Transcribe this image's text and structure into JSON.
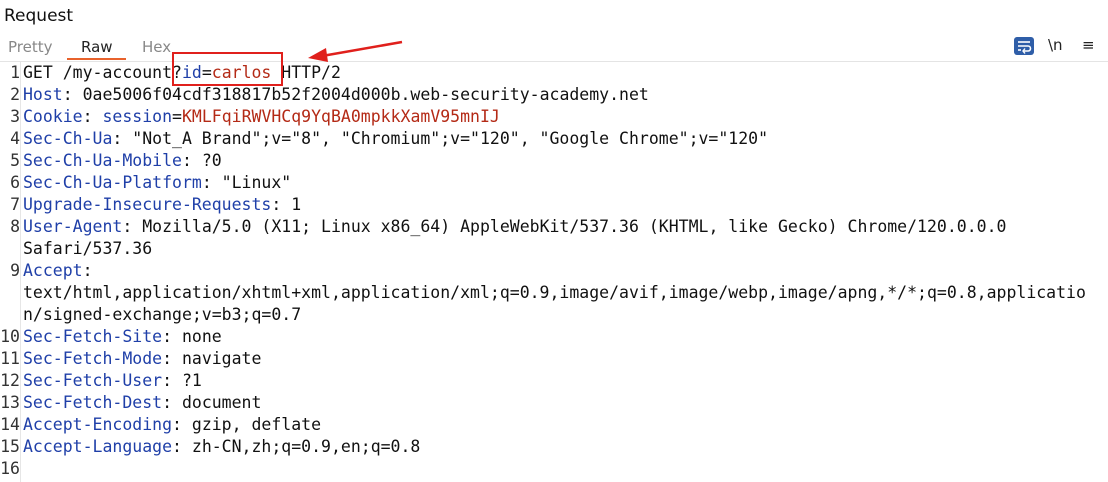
{
  "panel": {
    "title": "Request"
  },
  "tabs": [
    {
      "label": "Pretty",
      "active": false
    },
    {
      "label": "Raw",
      "active": true
    },
    {
      "label": "Hex",
      "active": false
    }
  ],
  "toolbar": {
    "wrap_icon": "word-wrap-icon",
    "newline_label": "\\n",
    "menu_label": "≡"
  },
  "colors": {
    "key": "#1f3fa8",
    "value": "#b42a16",
    "accent_tab": "#e8622c",
    "highlight_box": "#e0201c"
  },
  "lines": [
    {
      "n": "1",
      "parts": [
        {
          "t": "GET /my-account",
          "c": "p"
        },
        {
          "t": "?",
          "c": "p"
        },
        {
          "t": "id",
          "c": "k"
        },
        {
          "t": "=",
          "c": "p"
        },
        {
          "t": "carlos",
          "c": "v"
        },
        {
          "t": " HTTP/2",
          "c": "p"
        }
      ]
    },
    {
      "n": "2",
      "parts": [
        {
          "t": "Host",
          "c": "k"
        },
        {
          "t": ": 0ae5006f04cdf318817b52f2004d000b.web-security-academy.net",
          "c": "p"
        }
      ]
    },
    {
      "n": "3",
      "parts": [
        {
          "t": "Cookie",
          "c": "k"
        },
        {
          "t": ": ",
          "c": "p"
        },
        {
          "t": "session",
          "c": "k"
        },
        {
          "t": "=",
          "c": "p"
        },
        {
          "t": "KMLFqiRWVHCq9YqBA0mpkkXamV95mnIJ",
          "c": "v"
        }
      ]
    },
    {
      "n": "4",
      "parts": [
        {
          "t": "Sec-Ch-Ua",
          "c": "k"
        },
        {
          "t": ": \"Not_A Brand\";v=\"8\", \"Chromium\";v=\"120\", \"Google Chrome\";v=\"120\"",
          "c": "p"
        }
      ]
    },
    {
      "n": "5",
      "parts": [
        {
          "t": "Sec-Ch-Ua-Mobile",
          "c": "k"
        },
        {
          "t": ": ?0",
          "c": "p"
        }
      ]
    },
    {
      "n": "6",
      "parts": [
        {
          "t": "Sec-Ch-Ua-Platform",
          "c": "k"
        },
        {
          "t": ": \"Linux\"",
          "c": "p"
        }
      ]
    },
    {
      "n": "7",
      "parts": [
        {
          "t": "Upgrade-Insecure-Requests",
          "c": "k"
        },
        {
          "t": ": 1",
          "c": "p"
        }
      ]
    },
    {
      "n": "8",
      "parts": [
        {
          "t": "User-Agent",
          "c": "k"
        },
        {
          "t": ": Mozilla/5.0 (X11; Linux x86_64) AppleWebKit/537.36 (KHTML, like Gecko) Chrome/120.0.0.0",
          "c": "p"
        }
      ]
    },
    {
      "n": "",
      "parts": [
        {
          "t": "Safari/537.36",
          "c": "p"
        }
      ]
    },
    {
      "n": "9",
      "parts": [
        {
          "t": "Accept",
          "c": "k"
        },
        {
          "t": ":",
          "c": "p"
        }
      ]
    },
    {
      "n": "",
      "parts": [
        {
          "t": "text/html,application/xhtml+xml,application/xml;q=0.9,image/avif,image/webp,image/apng,*/*;q=0.8,applicatio",
          "c": "p"
        }
      ]
    },
    {
      "n": "",
      "parts": [
        {
          "t": "n/signed-exchange;v=b3;q=0.7",
          "c": "p"
        }
      ]
    },
    {
      "n": "10",
      "parts": [
        {
          "t": "Sec-Fetch-Site",
          "c": "k"
        },
        {
          "t": ": none",
          "c": "p"
        }
      ]
    },
    {
      "n": "11",
      "parts": [
        {
          "t": "Sec-Fetch-Mode",
          "c": "k"
        },
        {
          "t": ": navigate",
          "c": "p"
        }
      ]
    },
    {
      "n": "12",
      "parts": [
        {
          "t": "Sec-Fetch-User",
          "c": "k"
        },
        {
          "t": ": ?1",
          "c": "p"
        }
      ]
    },
    {
      "n": "13",
      "parts": [
        {
          "t": "Sec-Fetch-Dest",
          "c": "k"
        },
        {
          "t": ": document",
          "c": "p"
        }
      ]
    },
    {
      "n": "14",
      "parts": [
        {
          "t": "Accept-Encoding",
          "c": "k"
        },
        {
          "t": ": gzip, deflate",
          "c": "p"
        }
      ]
    },
    {
      "n": "15",
      "parts": [
        {
          "t": "Accept-Language",
          "c": "k"
        },
        {
          "t": ": zh-CN,zh;q=0.9,en;q=0.8",
          "c": "p"
        }
      ]
    },
    {
      "n": "16",
      "parts": []
    }
  ]
}
